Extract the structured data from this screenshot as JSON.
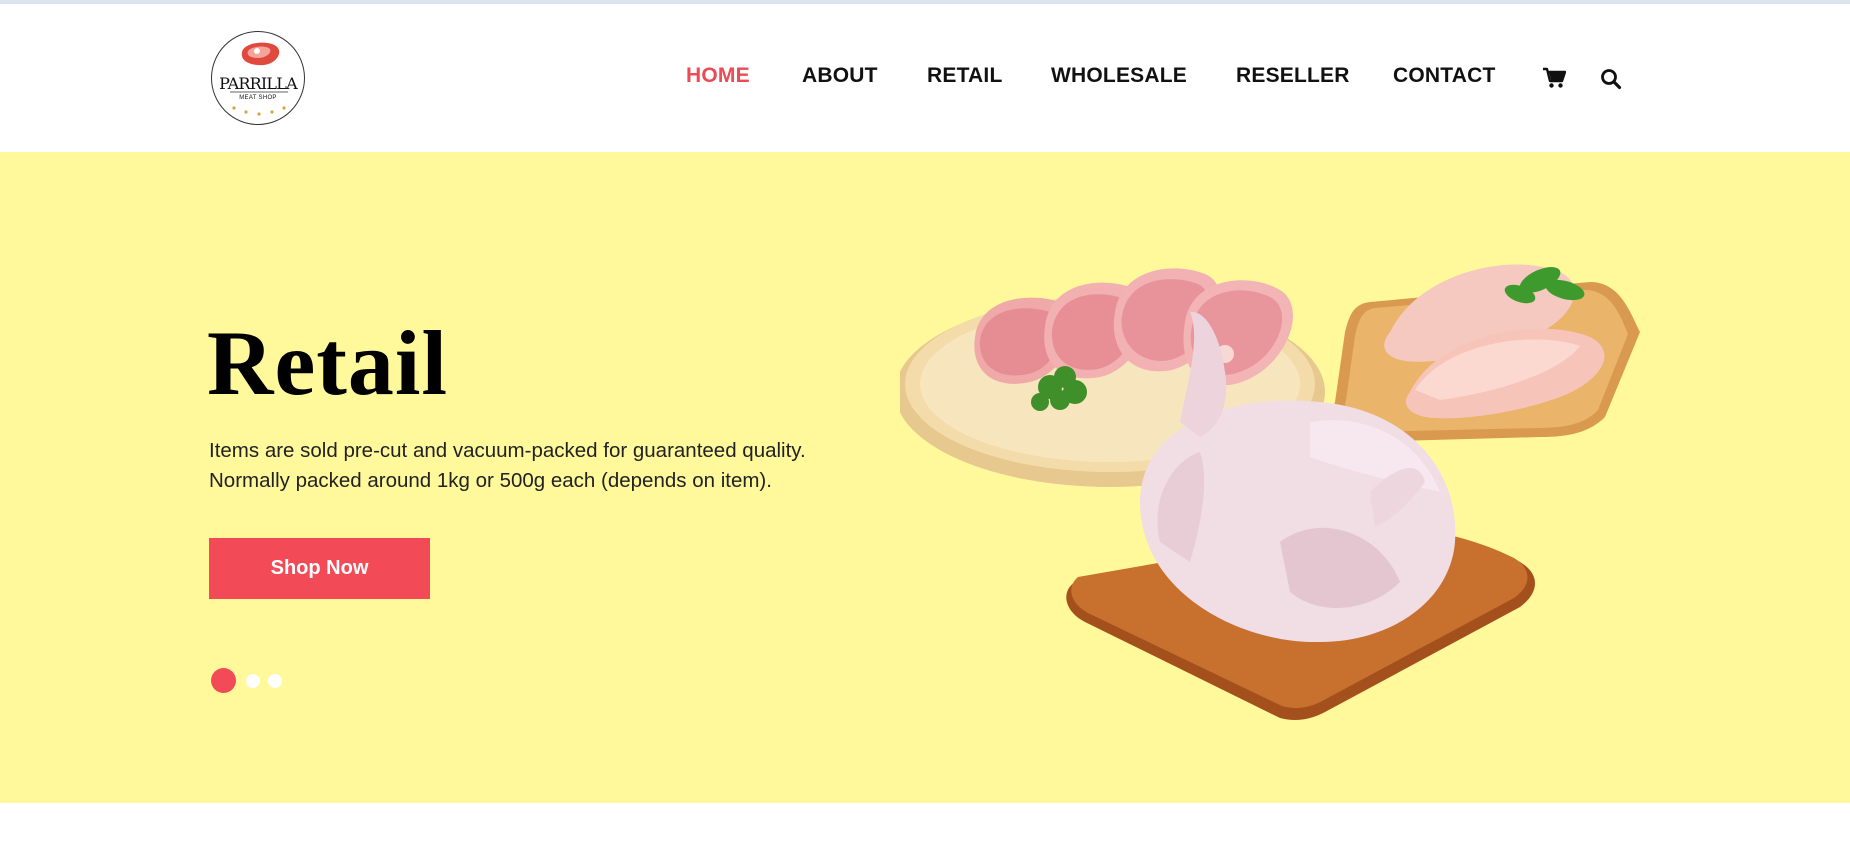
{
  "brand": {
    "name": "PARRILLA",
    "tagline": "MEAT SHOP",
    "logo_icon": "steak-icon",
    "accent_color": "#f24a57"
  },
  "nav": {
    "items": [
      {
        "label": "HOME",
        "active": true
      },
      {
        "label": "ABOUT",
        "active": false
      },
      {
        "label": "RETAIL",
        "active": false
      },
      {
        "label": "WHOLESALE",
        "active": false
      },
      {
        "label": "RESELLER",
        "active": false
      },
      {
        "label": "CONTACT",
        "active": false
      }
    ],
    "icons": [
      "cart-icon",
      "search-icon"
    ],
    "active_color": "#ec4a55"
  },
  "hero": {
    "title": "Retail",
    "lines": [
      "Items are sold pre-cut and vacuum-packed for guaranteed quality.",
      "Normally packed around 1kg or 500g each (depends on item)."
    ],
    "cta_label": "Shop Now",
    "background_color": "#fff99b",
    "slider": {
      "count": 3,
      "active_index": 0
    },
    "image_subject": "raw-meat-and-chicken-on-cutting-boards"
  }
}
